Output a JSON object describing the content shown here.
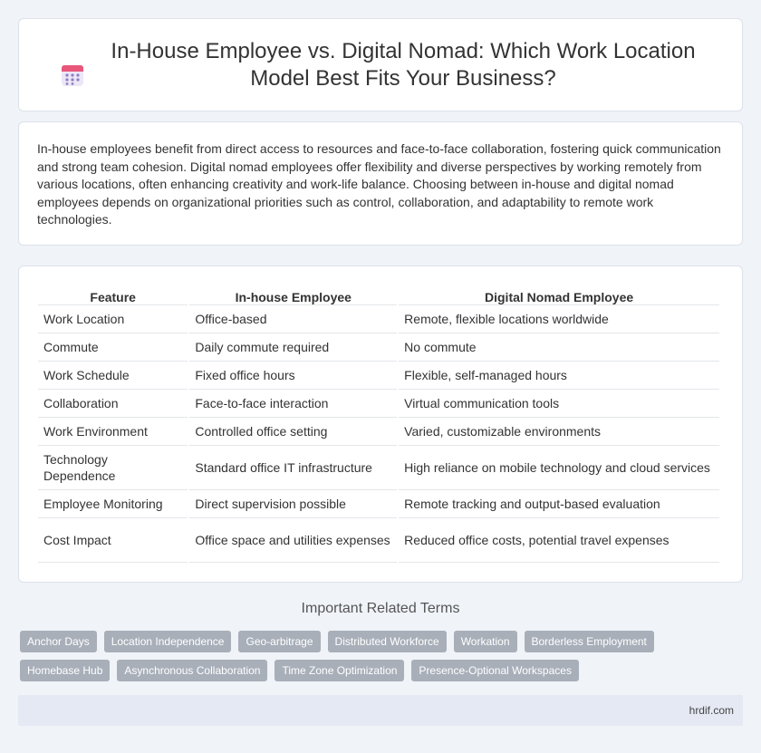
{
  "header": {
    "title": "In-House Employee vs. Digital Nomad: Which Work Location Model Best Fits Your Business?",
    "icon": "calendar-icon",
    "icon_colors": {
      "top": "#e8567a",
      "body": "#ede6f7",
      "dots": "#8a7fc2"
    }
  },
  "intro": {
    "text": "In-house employees benefit from direct access to resources and face-to-face collaboration, fostering quick communication and strong team cohesion. Digital nomad employees offer flexibility and diverse perspectives by working remotely from various locations, often enhancing creativity and work-life balance. Choosing between in-house and digital nomad employees depends on organizational priorities such as control, collaboration, and adaptability to remote work technologies."
  },
  "table": {
    "headers": [
      "Feature",
      "In-house Employee",
      "Digital Nomad Employee"
    ],
    "rows": [
      [
        "Work Location",
        "Office-based",
        "Remote, flexible locations worldwide"
      ],
      [
        "Commute",
        "Daily commute required",
        "No commute"
      ],
      [
        "Work Schedule",
        "Fixed office hours",
        "Flexible, self-managed hours"
      ],
      [
        "Collaboration",
        "Face-to-face interaction",
        "Virtual communication tools"
      ],
      [
        "Work Environment",
        "Controlled office setting",
        "Varied, customizable environments"
      ],
      [
        "Technology Dependence",
        "Standard office IT infrastructure",
        "High reliance on mobile technology and cloud services"
      ],
      [
        "Employee Monitoring",
        "Direct supervision possible",
        "Remote tracking and output-based evaluation"
      ],
      [
        "Cost Impact",
        "Office space and utilities expenses",
        "Reduced office costs, potential travel expenses"
      ]
    ]
  },
  "related": {
    "title": "Important Related Terms",
    "tags": [
      "Anchor Days",
      "Location Independence",
      "Geo-arbitrage",
      "Distributed Workforce",
      "Workation",
      "Borderless Employment",
      "Homebase Hub",
      "Asynchronous Collaboration",
      "Time Zone Optimization",
      "Presence-Optional Workspaces"
    ]
  },
  "footer": {
    "site": "hrdif.com"
  }
}
